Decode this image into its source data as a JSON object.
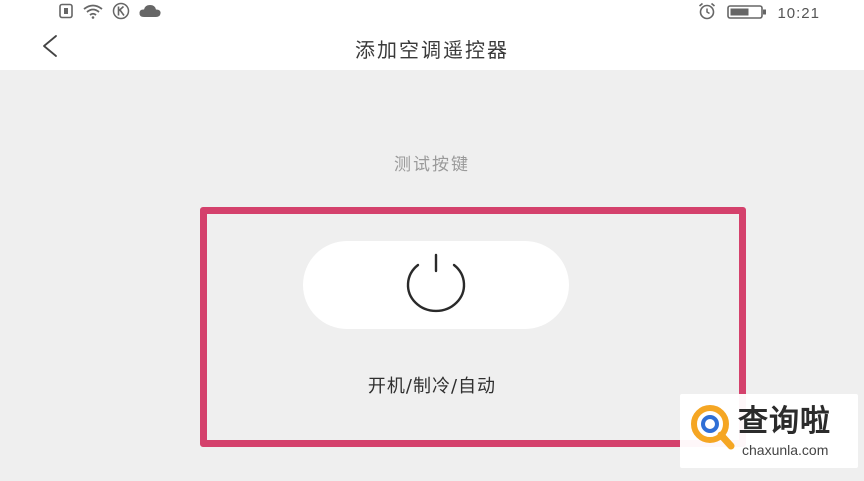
{
  "status_bar": {
    "time": "10:21",
    "icons": [
      "sim-icon",
      "wifi-icon",
      "k-badge-icon",
      "cloud-icon",
      "alarm-icon",
      "battery-icon"
    ]
  },
  "nav": {
    "back_icon": "chevron-left-icon",
    "title": "添加空调遥控器"
  },
  "test_section": {
    "hint": "测试按键",
    "power_icon": "power-icon",
    "key_label": "开机/制冷/自动"
  },
  "highlight": {
    "color": "#d4416c"
  },
  "watermark": {
    "brand": "查询啦",
    "url": "chaxunla.com",
    "accent_orange": "#f5a623",
    "accent_blue": "#2f6fd6"
  }
}
